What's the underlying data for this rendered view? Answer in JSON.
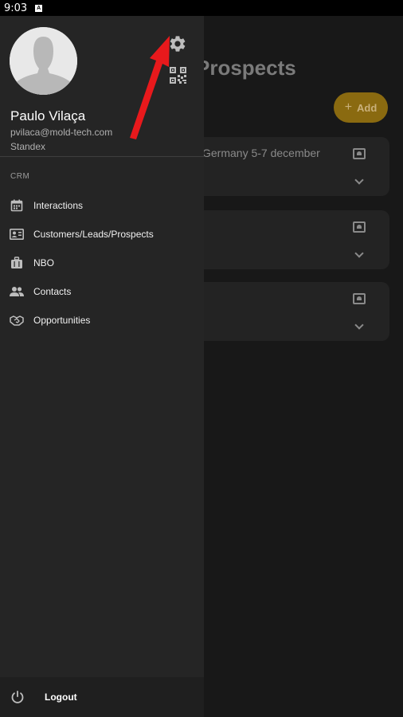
{
  "status_bar": {
    "time": "9:03",
    "notification_icon": "A"
  },
  "background_page": {
    "title": "Prospects",
    "add_button": {
      "label": "Add",
      "icon": "plus-icon"
    },
    "cards": [
      {
        "text": "Germany 5-7 december"
      },
      {
        "text": ""
      },
      {
        "text": ""
      }
    ]
  },
  "drawer": {
    "user": {
      "name": "Paulo Vilaça",
      "email": "pvilaca@mold-tech.com",
      "company": "Standex"
    },
    "section_label": "CRM",
    "items": [
      {
        "label": "Interactions",
        "icon": "calendar-icon"
      },
      {
        "label": "Customers/Leads/Prospects",
        "icon": "contact-card-icon"
      },
      {
        "label": "NBO",
        "icon": "luggage-icon"
      },
      {
        "label": "Contacts",
        "icon": "people-icon"
      },
      {
        "label": "Opportunities",
        "icon": "handshake-icon"
      }
    ],
    "logout": {
      "label": "Logout",
      "icon": "power-icon"
    }
  },
  "colors": {
    "drawer_bg": "#252525",
    "annotation_arrow": "#e8191c",
    "add_button": "#8a6a10"
  }
}
